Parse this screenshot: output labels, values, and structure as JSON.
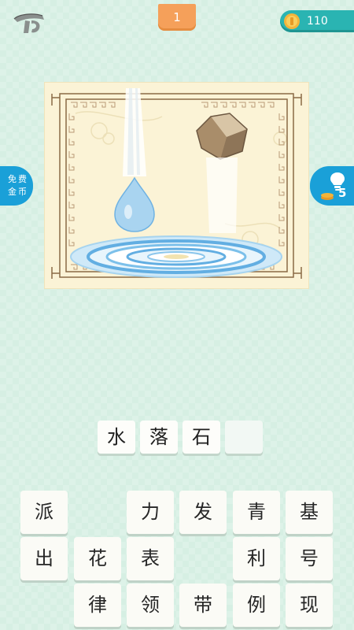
{
  "level": "1",
  "coins": "110",
  "side_tabs": {
    "free_coins_line1": "免费",
    "free_coins_line2": "金币",
    "hint_count": "5"
  },
  "answer": [
    "水",
    "落",
    "石",
    ""
  ],
  "keyboard": [
    [
      "派",
      "",
      "力",
      "发",
      "青",
      "基"
    ],
    [
      "出",
      "花",
      "表",
      "",
      "利",
      "号"
    ],
    [
      "",
      "律",
      "领",
      "带",
      "例",
      "现"
    ]
  ],
  "icons": {
    "back": "back-icon",
    "coin": "coin-icon",
    "hint": "lightbulb-icon"
  },
  "colors": {
    "level_badge": "#f5a05a",
    "coins_bar": "#2ab4b2",
    "side_tab": "#1aa0d8",
    "background": "#d6efe3"
  }
}
